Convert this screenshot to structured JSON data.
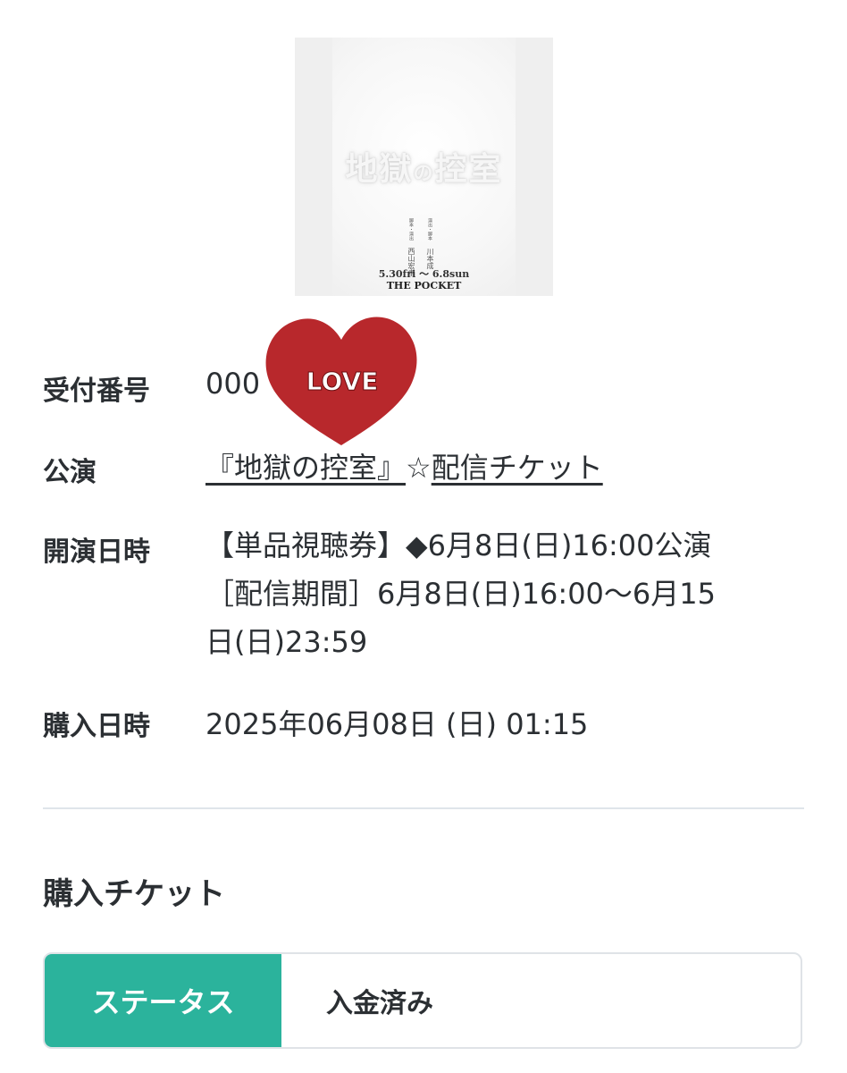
{
  "poster": {
    "title_part1": "地獄",
    "title_part2": "の",
    "title_part3": "控室",
    "credits": [
      {
        "role": "脚本・演出",
        "name": "西山宏幸"
      },
      {
        "role": "演出・脚本",
        "name": "川本成"
      }
    ],
    "dates": "5.30fri 〜 6.8sun",
    "venue": "THE POCKET"
  },
  "info": {
    "receipt_label": "受付番号",
    "receipt_value": "000",
    "performance_label": "公演",
    "performance_link": "『地獄の控室』",
    "performance_star": "☆",
    "performance_ticket": "配信チケット",
    "showtime_label": "開演日時",
    "showtime_line1": "【単品視聴券】◆6月8日(日)16:00公演",
    "showtime_line2": "［配信期間］6月8日(日)16:00〜6月15",
    "showtime_line3": "日(日)23:59",
    "purchase_label": "購入日時",
    "purchase_value": "2025年06月08日 (日) 01:15"
  },
  "tickets": {
    "section_title": "購入チケット",
    "status_label": "ステータス",
    "status_value": "入金済み"
  },
  "sticker": {
    "text": "LOVE",
    "color": "#b8282c"
  }
}
